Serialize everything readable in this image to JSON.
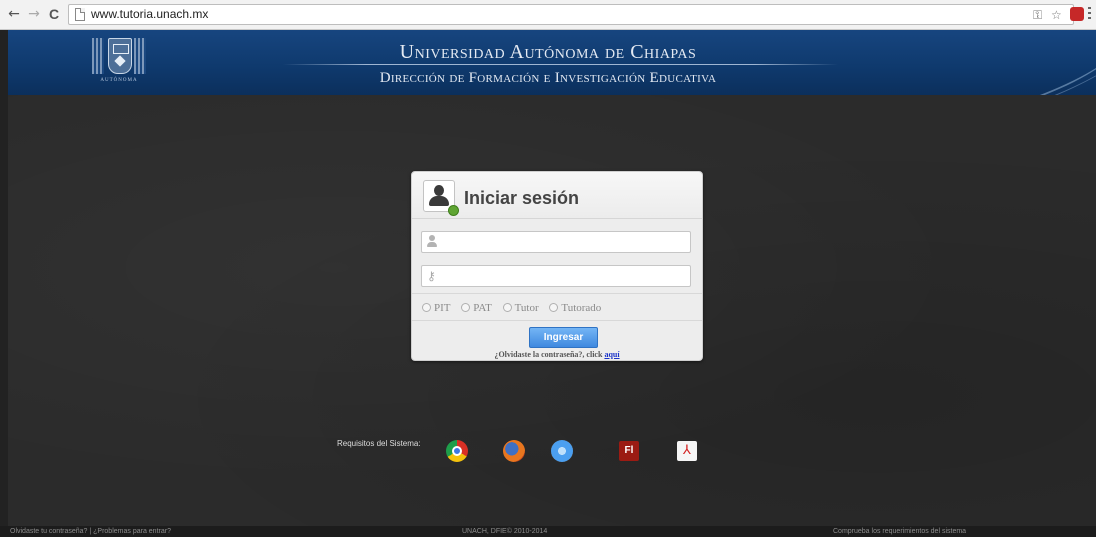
{
  "browser": {
    "back_icon": "←",
    "forward_icon": "→",
    "reload_icon": "C",
    "url": "www.tutoria.unach.mx",
    "key_icon": "⚿",
    "star_icon": "☆"
  },
  "header": {
    "title": "Universidad Autónoma de Chiapas",
    "subtitle": "Dirección de Formación e Investigación Educativa",
    "logo_caption": "AUTÓNOMA"
  },
  "login": {
    "title": "Iniciar sesión",
    "username_value": "",
    "password_value": "",
    "roles": [
      "PIT",
      "PAT",
      "Tutor",
      "Tutorado"
    ],
    "submit_label": "Ingresar",
    "forgot_text": "¿Olvidaste la contraseña?, click",
    "forgot_link": "aquí"
  },
  "requirements": {
    "label": "Requisitos del Sistema:",
    "flash_label": "Fl",
    "pdf_label": "⅄"
  },
  "footer": {
    "left": "Olvidaste tu contraseña? | ¿Problemas para entrar?",
    "center": "UNACH, DFIE© 2010-2014",
    "right": "Comprueba los requerimientos del sistema"
  }
}
